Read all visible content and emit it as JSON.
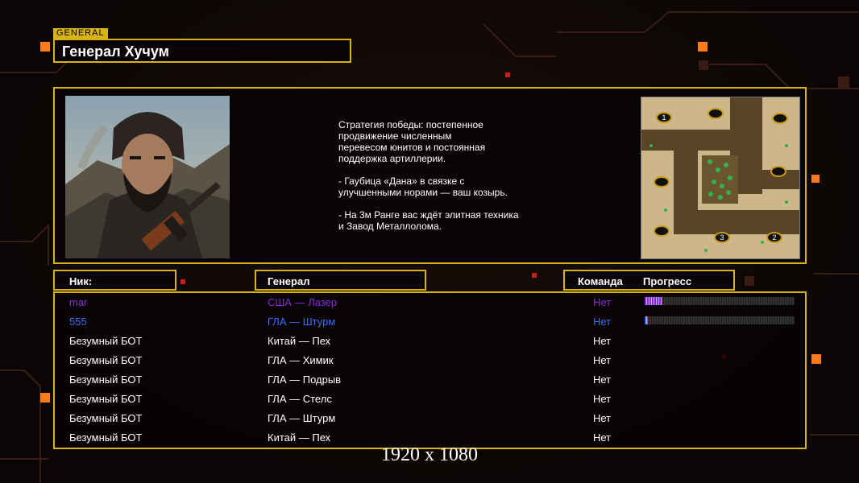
{
  "tag": "GENERAL",
  "general_name": "Генерал Хучум",
  "description": "Стратегия победы: постепенное\nпродвижение численным\nперевесом юнитов и постоянная\nподдержка артиллерии.\n\n- Гаубица «Дана» в связке с\nулучшенными норами — ваш козырь.\n\n- На 3м Ранге вас ждёт элитная техника\nи Завод Металлолома.",
  "minimap_labels": [
    "1",
    "2",
    "3"
  ],
  "headers": {
    "nick": "Ник:",
    "general": "Генерал",
    "team": "Команда",
    "progress": "Прогресс"
  },
  "players": [
    {
      "nick": "mar",
      "general": "США — Лазер",
      "team": "Нет",
      "color": "#8a2be2",
      "progress": 0.12
    },
    {
      "nick": "555",
      "general": "ГЛА — Штурм",
      "team": "Нет",
      "color": "#3c6cff",
      "progress": 0.02
    },
    {
      "nick": "Безумный БОТ",
      "general": "Китай — Пех",
      "team": "Нет",
      "color": "#ffffff"
    },
    {
      "nick": "Безумный БОТ",
      "general": "ГЛА — Химик",
      "team": "Нет",
      "color": "#ffffff"
    },
    {
      "nick": "Безумный БОТ",
      "general": "ГЛА — Подрыв",
      "team": "Нет",
      "color": "#ffffff"
    },
    {
      "nick": "Безумный БОТ",
      "general": "ГЛА — Стелс",
      "team": "Нет",
      "color": "#ffffff"
    },
    {
      "nick": "Безумный БОТ",
      "general": "ГЛА — Штурм",
      "team": "Нет",
      "color": "#ffffff"
    },
    {
      "nick": "Безумный БОТ",
      "general": "Китай — Пех",
      "team": "Нет",
      "color": "#ffffff"
    }
  ],
  "resolution": "1920 x 1080",
  "colors": {
    "accent": "#d9b316",
    "background": "#0b0605",
    "glow": "#ff7a1a"
  }
}
